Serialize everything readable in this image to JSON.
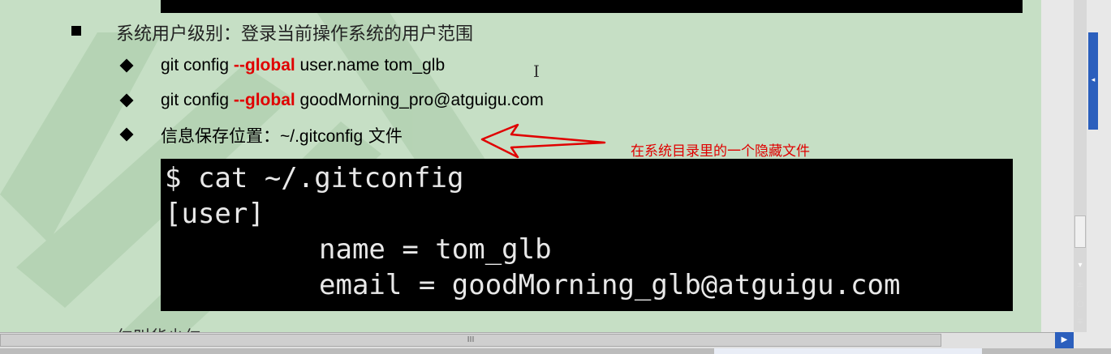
{
  "slide": {
    "heading": "系统用户级别：登录当前操作系统的用户范围",
    "items": [
      {
        "pre": "git config ",
        "flag": "--global",
        "post": " user.name tom_glb"
      },
      {
        "pre": "git config ",
        "flag": "--global",
        "post": " goodMorning_pro@atguigu.com"
      },
      {
        "label": "信息保存位置：",
        "path": "~/.gitconfig",
        "suffix": " 文件"
      }
    ],
    "annotation": "在系统目录里的一个隐藏文件",
    "terminal": {
      "lines": [
        "$ cat ~/.gitconfig",
        "[user]",
        "name = tom_glb",
        "email = goodMorning_glb@atguigu.com"
      ]
    },
    "cut_text": "仁叫华少仁"
  },
  "scrollbar": {
    "thumb_glyph": "III",
    "right_arrow": "▶",
    "side_buttons": [
      "◂",
      "▾",
      "±",
      "○",
      "∓"
    ]
  },
  "colors": {
    "slide_bg": "#c6dfc5",
    "accent_red": "#e00000",
    "terminal_bg": "#000000",
    "scroll_blue": "#2b5fbd"
  }
}
